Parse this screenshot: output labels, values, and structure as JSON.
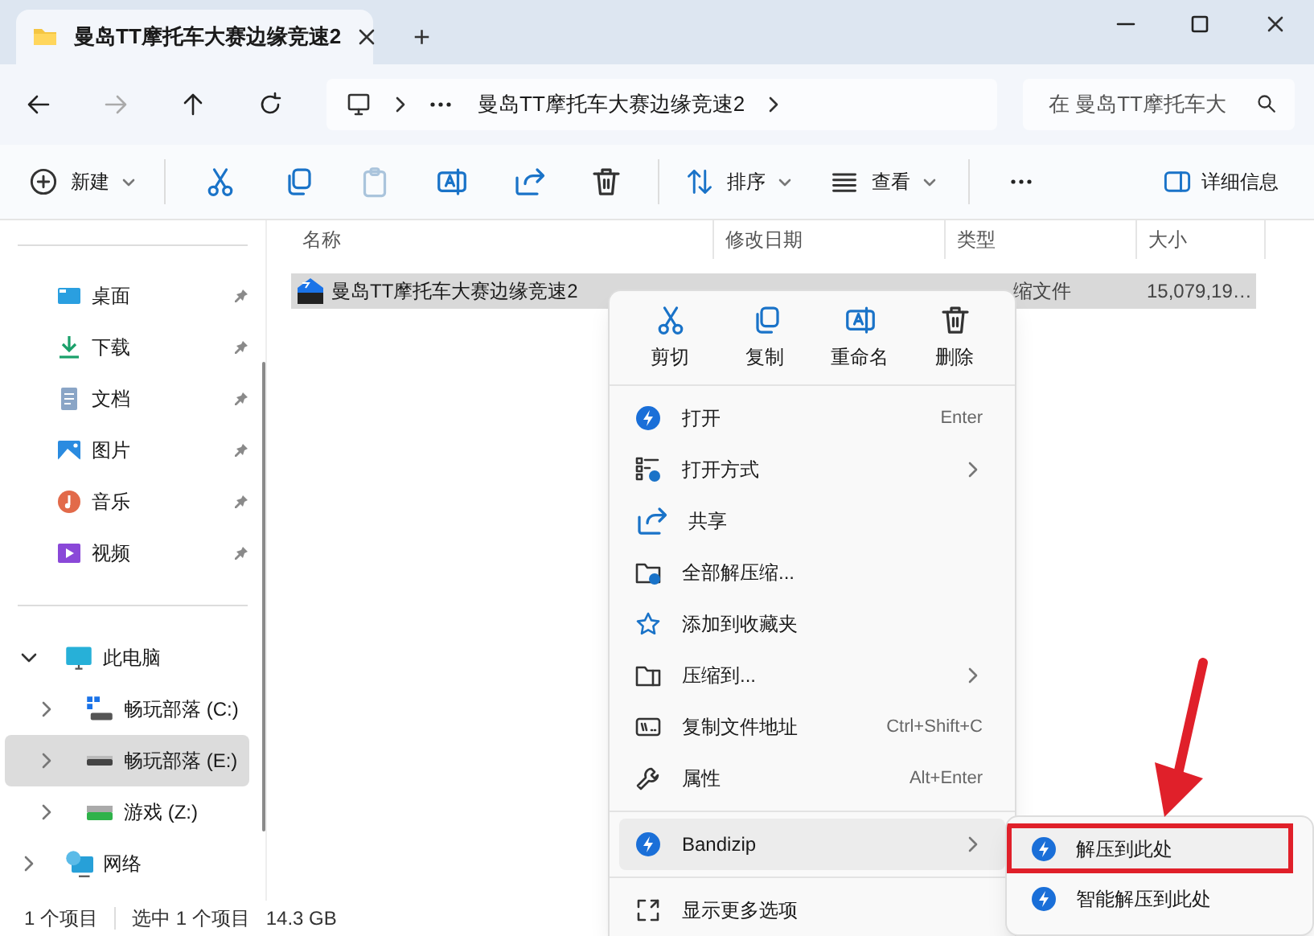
{
  "window": {
    "tab_title": "曼岛TT摩托车大赛边缘竞速2",
    "new_tab": "+"
  },
  "address_bar": {
    "crumbs": [
      "曼岛TT摩托车大赛边缘竞速2"
    ],
    "search_placeholder": "在 曼岛TT摩托车大"
  },
  "toolbar": {
    "new": "新建",
    "sort": "排序",
    "view": "查看",
    "details": "详细信息"
  },
  "sidebar": {
    "quick_access": [
      {
        "label": "桌面",
        "pinned": true
      },
      {
        "label": "下载",
        "pinned": true
      },
      {
        "label": "文档",
        "pinned": true
      },
      {
        "label": "图片",
        "pinned": true
      },
      {
        "label": "音乐",
        "pinned": true
      },
      {
        "label": "视频",
        "pinned": true
      }
    ],
    "this_pc": {
      "label": "此电脑",
      "expanded": true,
      "drives": [
        {
          "label": "畅玩部落 (C:)",
          "selected": false
        },
        {
          "label": "畅玩部落 (E:)",
          "selected": true
        },
        {
          "label": "游戏 (Z:)",
          "selected": false
        }
      ]
    },
    "network": {
      "label": "网络",
      "expanded": false
    }
  },
  "columns": [
    "名称",
    "修改日期",
    "类型",
    "大小"
  ],
  "files": [
    {
      "name": "曼岛TT摩托车大赛边缘竞速2",
      "type": "缩文件",
      "size": "15,079,19…",
      "selected": true
    }
  ],
  "context_menu": {
    "quick_actions": [
      {
        "label": "剪切"
      },
      {
        "label": "复制"
      },
      {
        "label": "重命名"
      },
      {
        "label": "删除"
      }
    ],
    "groups": [
      [
        {
          "label": "打开",
          "shortcut": "Enter",
          "submenu": false,
          "hovered": false
        },
        {
          "label": "打开方式",
          "submenu": true,
          "hovered": false
        },
        {
          "label": "共享",
          "submenu": false,
          "hovered": false
        },
        {
          "label": "全部解压缩...",
          "submenu": false,
          "hovered": false
        },
        {
          "label": "添加到收藏夹",
          "submenu": false,
          "hovered": false
        },
        {
          "label": "压缩到...",
          "submenu": true,
          "hovered": false
        },
        {
          "label": "复制文件地址",
          "shortcut": "Ctrl+Shift+C",
          "submenu": false,
          "hovered": false
        },
        {
          "label": "属性",
          "shortcut": "Alt+Enter",
          "submenu": false,
          "hovered": false
        }
      ],
      [
        {
          "label": "Bandizip",
          "submenu": true,
          "hovered": true
        }
      ],
      [
        {
          "label": "显示更多选项",
          "submenu": false,
          "hovered": false
        }
      ]
    ]
  },
  "submenu": {
    "items": [
      {
        "label": "解压到此处",
        "highlighted": true
      },
      {
        "label": "智能解压到此处",
        "highlighted": false
      }
    ]
  },
  "status_bar": {
    "count": "1 个项目",
    "selection": "选中 1 个项目",
    "size": "14.3 GB"
  }
}
